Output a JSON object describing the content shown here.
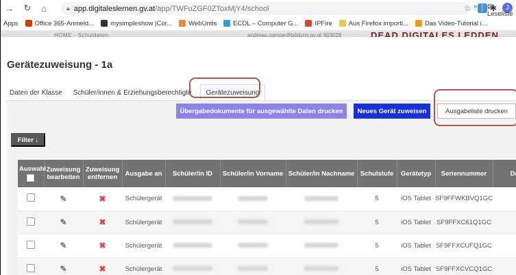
{
  "browser": {
    "url_host": "app.digitaleslernen.gv.at",
    "url_path": "/app/TWFuZGF0ZToxMjY4/school",
    "avatar_letter": "J",
    "bookmarks": [
      {
        "label": "Apps",
        "icon": "apps-icon",
        "color": ""
      },
      {
        "label": "Office 365-Anmeld...",
        "icon": "office-icon",
        "color": "#d83b01"
      },
      {
        "label": "mysimpleshow |Cor...",
        "icon": "mysimpleshow-icon",
        "color": "#333333"
      },
      {
        "label": "WebUntis",
        "icon": "webuntis-icon",
        "color": "#e88a3c"
      },
      {
        "label": "ECDL – Computer G...",
        "icon": "ecdl-icon",
        "color": "#2f9fd8"
      },
      {
        "label": "IPFire",
        "icon": "ipfire-icon",
        "color": "#d9472b"
      },
      {
        "label": "Aus Firefox importi...",
        "icon": "folder-icon",
        "color": "#f2c94c"
      },
      {
        "label": "Das Video-Tutorial i...",
        "icon": "video-icon",
        "color": "#f39c12"
      }
    ],
    "bookmarks_more": "»",
    "reading_list": "Leseliste"
  },
  "app_header": {
    "home": "HOME · Schuldaten",
    "user": "andreas.gampe@bildung.gv.at  903026",
    "brand": "DEAD DIGITALES LEDDEN"
  },
  "page": {
    "title": "Gerätezuweisung - 1a",
    "tabs": [
      {
        "label": "Daten der Klasse",
        "active": false
      },
      {
        "label": "Schüler/innen & Erziehungsberechtigte",
        "active": false
      },
      {
        "label": "Gerätezuweisung",
        "active": true
      }
    ]
  },
  "buttons": {
    "print_docs": "Übergabedokumente für ausgewählte Daten drucken",
    "new_device": "Neues Gerät zuweisen",
    "print_list": "Ausgabeliste drucken",
    "filter": "Filter ↓"
  },
  "table": {
    "headers": [
      "Auswahl",
      "Zuweisung bearbeiten",
      "Zuweisung entfernen",
      "Ausgabe an",
      "Schüler/in ID",
      "Schüler/in Vorname",
      "Schüler/in Nachname",
      "Schulstufe",
      "Gerätetyp",
      "Seriennummer",
      "Datu"
    ],
    "rows": [
      {
        "ausgabe": "Schülergerät",
        "stufe": "5",
        "typ": "iOS Tablet",
        "serial": "SF9FFWKBVQ1GC"
      },
      {
        "ausgabe": "Schülergerät",
        "stufe": "5",
        "typ": "iOS Tablet",
        "serial": "SF9FFXC61Q1GC"
      },
      {
        "ausgabe": "Schülergerät",
        "stufe": "5",
        "typ": "iOS Tablet",
        "serial": "SF9FFXCUFQ1GC"
      },
      {
        "ausgabe": "Schülergerät",
        "stufe": "5",
        "typ": "iOS Tablet",
        "serial": "SF9FFXCVCQ1GC"
      }
    ]
  },
  "colors": {
    "print_button": "#8c83ea",
    "new_button": "#1730d8",
    "highlight": "#b4564a",
    "remove_icon": "#e04848"
  }
}
